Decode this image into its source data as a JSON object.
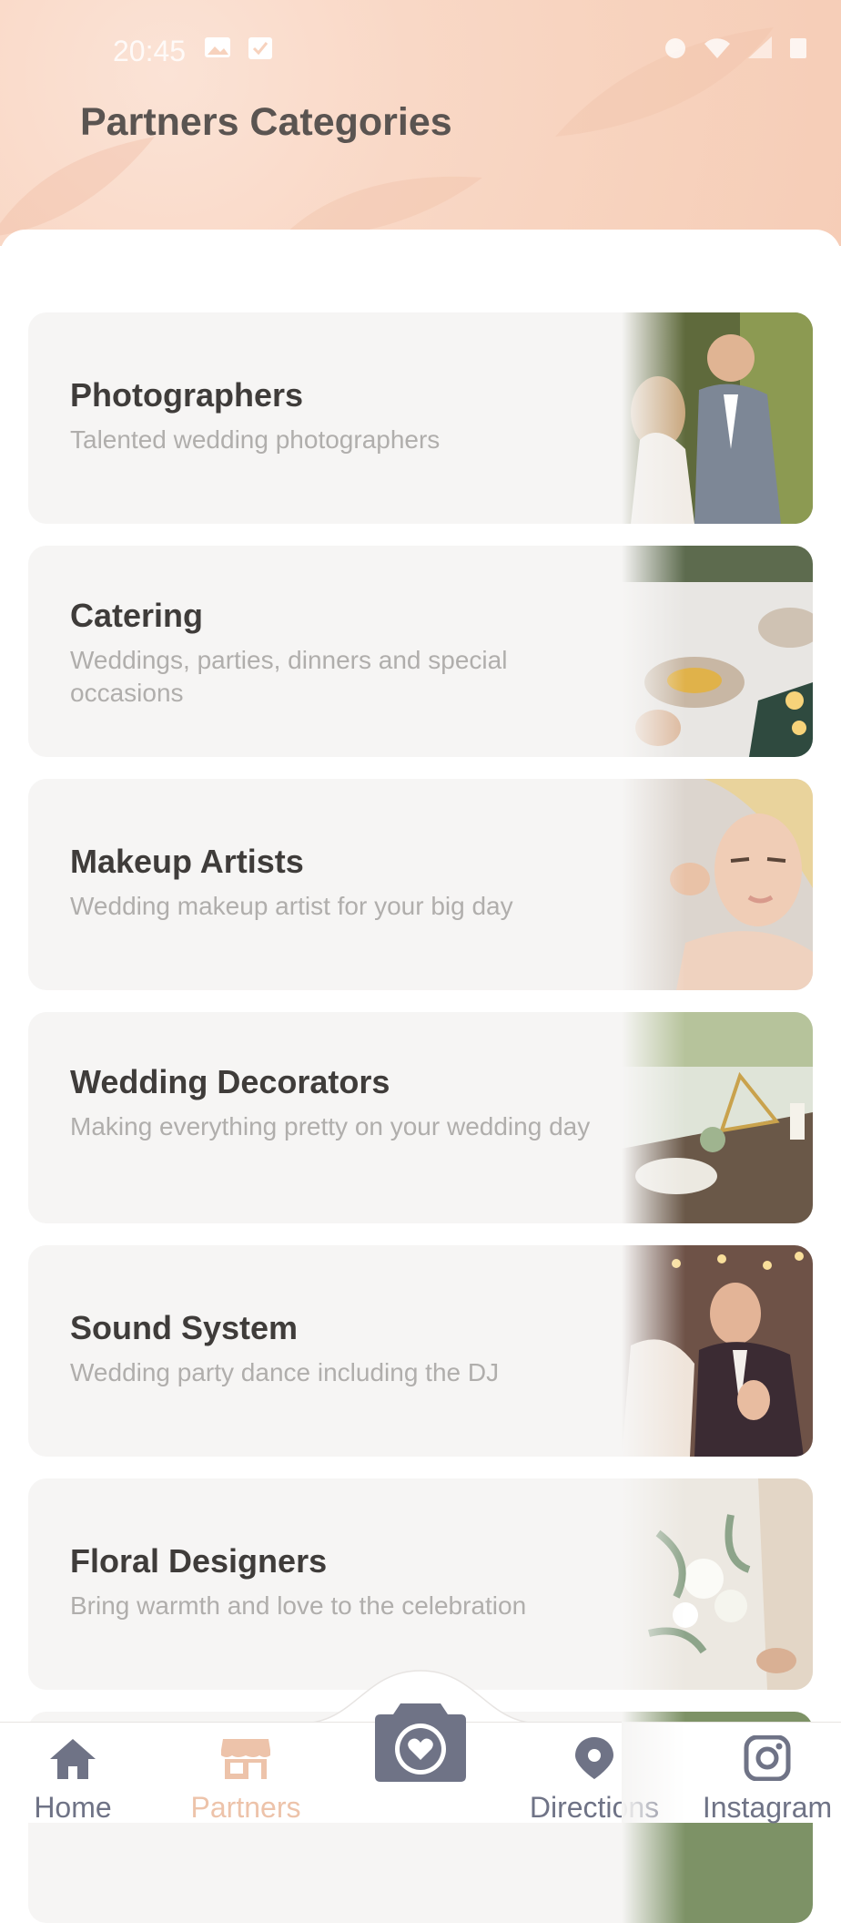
{
  "status": {
    "time": "20:45"
  },
  "header": {
    "title": "Partners Categories"
  },
  "categories": [
    {
      "title": "Photographers",
      "subtitle": "Talented wedding photographers"
    },
    {
      "title": "Catering",
      "subtitle": "Weddings, parties, dinners and special occasions"
    },
    {
      "title": "Makeup Artists",
      "subtitle": "Wedding makeup artist for your big day"
    },
    {
      "title": "Wedding Decorators",
      "subtitle": "Making everything pretty on your wedding day"
    },
    {
      "title": "Sound System",
      "subtitle": "Wedding party dance including the DJ"
    },
    {
      "title": "Floral Designers",
      "subtitle": "Bring warmth and love to the celebration"
    }
  ],
  "nav": {
    "home": "Home",
    "partners": "Partners",
    "directions": "Directions",
    "instagram": "Instagram",
    "active_color": "#edc3aa",
    "inactive_color": "#6f7386"
  }
}
